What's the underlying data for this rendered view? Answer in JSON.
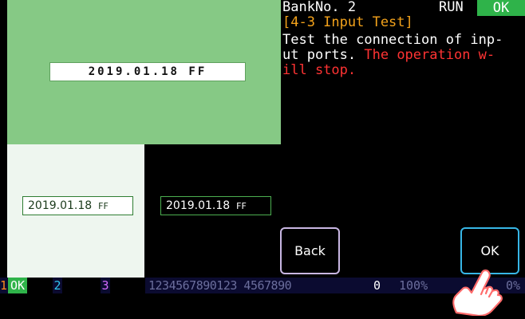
{
  "camera": {
    "stamp": "2019.01.18 FF"
  },
  "dates": [
    {
      "text": "2019.01.18",
      "suffix": "FF"
    },
    {
      "text": "2019.01.18",
      "suffix": "FF"
    }
  ],
  "header": {
    "bank": "BankNo. 2",
    "run": "RUN",
    "status": "OK"
  },
  "section_title": "[4-3 Input Test]",
  "description": {
    "line1": "Test the connection of inp-",
    "line2_white": "ut ports.",
    "line2_red": "The operation w-",
    "line3": "ill stop."
  },
  "buttons": {
    "back": "Back",
    "ok": "OK"
  },
  "status_bar": {
    "slot1_num": "1",
    "slot1_status": "OK",
    "slot2_num": "2",
    "slot3_num": "3",
    "digits": "1234567890123 4567890",
    "count": "0",
    "percent": "100%",
    "last_percent": "0%"
  },
  "colors": {
    "accent_green": "#2fb34a",
    "title_orange": "#f3a21b",
    "warning_red": "#ff3333",
    "ok_border": "#37b6e6"
  },
  "icons": [
    "tap-hand-icon"
  ]
}
